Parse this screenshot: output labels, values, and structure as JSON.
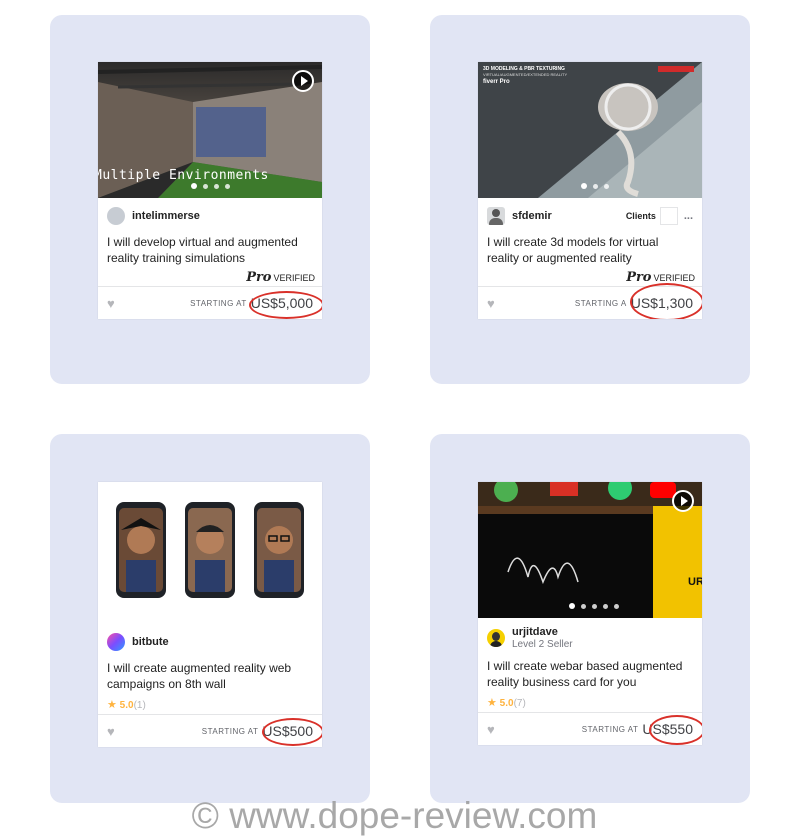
{
  "cards": [
    {
      "seller": "intelimmerse",
      "title": "I will develop virtual and augmented reality training simulations",
      "thumb_text": "Multiple Environments",
      "pro_logo": "Pro",
      "pro_label": "VERIFIED",
      "starting_label": "STARTING AT",
      "price": "US$5,000",
      "has_video": true
    },
    {
      "seller": "sfdemir",
      "clients_label": "Clients",
      "more_icon": "...",
      "title": "I will create 3d models for virtual reality or augmented reality",
      "thumb_heading": "3D MODELING & PBR TEXTURING",
      "thumb_sub": "VIRTUAL/AUGMENTED/EXTENDED REALITY",
      "thumb_brand": "fiverr Pro",
      "pro_logo": "Pro",
      "pro_label": "VERIFIED",
      "starting_label": "STARTING A",
      "price": "US$1,300"
    },
    {
      "seller": "bitbute",
      "title": "I will create augmented reality web campaigns on 8th wall",
      "rating": "5.0",
      "reviews": "(1)",
      "starting_label": "STARTING AT",
      "price": "US$500"
    },
    {
      "seller": "urjitdave",
      "level": "Level 2 Seller",
      "title": "I will create webar based augmented reality business card for you",
      "thumb_text": "UR",
      "rating": "5.0",
      "reviews": "(7)",
      "starting_label": "STARTING AT",
      "price": "US$550",
      "has_video": true
    }
  ],
  "watermark": "© www.dope-review.com",
  "colors": {
    "panel": "#e1e5f4",
    "highlight_ring": "#d9312a",
    "star": "#ffb33e"
  }
}
